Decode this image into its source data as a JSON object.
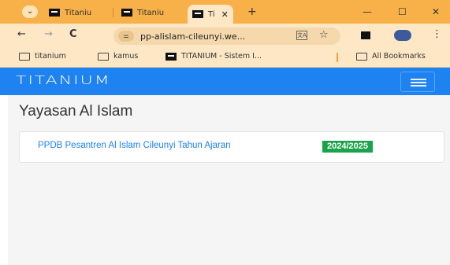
{
  "browser": {
    "tabs": [
      {
        "title": "Titaniu"
      },
      {
        "title": "Titaniu"
      },
      {
        "title": "Ti",
        "active": true
      }
    ],
    "new_tab_icon": "plus-icon",
    "window_controls": {
      "minimize": "—",
      "maximize": "☐",
      "close": "✕"
    },
    "address": "pp-alislam-cileunyi.we...",
    "bookmarks": [
      {
        "label": "titanium",
        "icon": "folder-icon"
      },
      {
        "label": "kamus",
        "icon": "folder-icon"
      },
      {
        "label": "TITANIUM - Sistem I...",
        "icon": "titanium-favicon"
      },
      {
        "label": "All Bookmarks",
        "icon": "folder-icon"
      }
    ]
  },
  "site": {
    "brand": "TITANIUM",
    "accent_color": "#1e82f0",
    "page_title": "Yayasan Al Islam",
    "card": {
      "link_text": "PPDB Pesantren Al Islam Cileunyi Tahun Ajaran",
      "badge": "2024/2025",
      "badge_color": "#1aa34a"
    }
  }
}
